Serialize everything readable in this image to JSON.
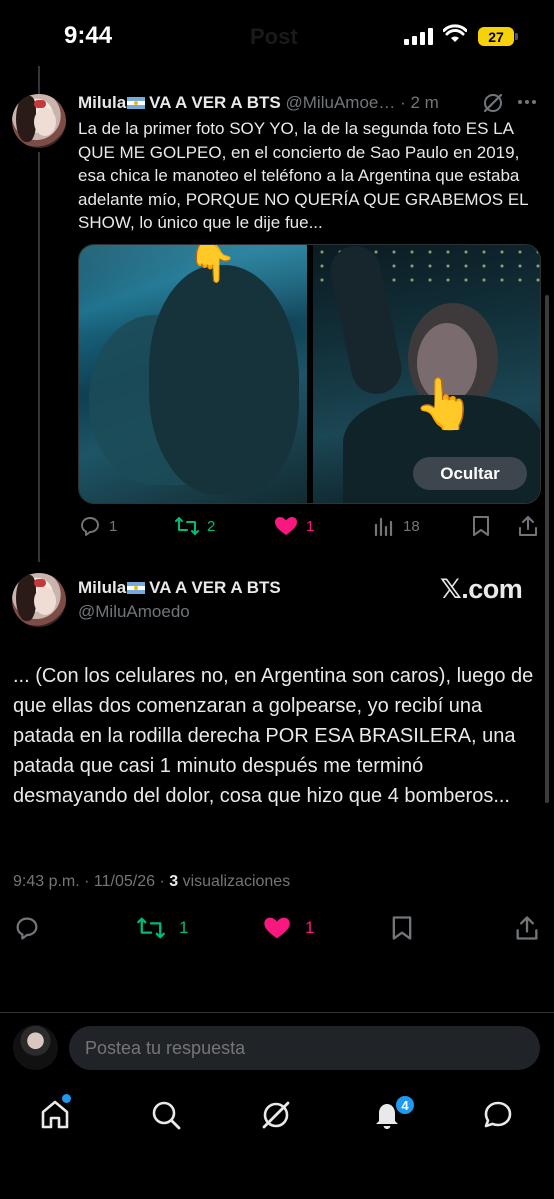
{
  "status_bar": {
    "time": "9:44",
    "battery": "27",
    "header_title": "Post"
  },
  "reply_post": {
    "display_name": "Milula",
    "name_suffix": "VA A VER A BTS",
    "handle": "@MiluAmoe…",
    "time": "· 2 m",
    "text": "La de la primer foto SOY YO, la de la segunda foto ES LA QUE ME GOLPEO, en el concierto de Sao Paulo en 2019, esa chica le manoteo el teléfono a la Argentina que estaba adelante mío, PORQUE NO QUERÍA QUE GRABEMOS EL SHOW, lo único que le dije fue...",
    "hide_button": "Ocultar",
    "hand_emoji_1": "👆",
    "hand_emoji_2": "👆",
    "replies": "1",
    "reposts": "2",
    "likes": "1",
    "views": "18"
  },
  "main_post": {
    "display_name": "Milula",
    "name_suffix": "VA A VER A BTS",
    "handle": "@MiluAmoedo",
    "brand": "𝕏.com",
    "text": "... (Con los celulares no, en Argentina son caros), luego de que ellas dos comenzaran a golpearse, yo recibí una patada en la rodilla derecha POR ESA BRASILERA, una patada que  casi 1 minuto después me terminó desmayando del dolor, cosa que hizo que 4 bomberos...",
    "timestamp": "9:43 p.m. · 11/05/26 · ",
    "views_count": "3",
    "views_label": " visualizaciones",
    "reposts": "1",
    "likes": "1"
  },
  "reply_box": {
    "placeholder": "Postea tu respuesta"
  },
  "bottom_nav": {
    "notifications_badge": "4"
  },
  "colors": {
    "accent": "#1d9bf0",
    "like": "#f91880",
    "repost": "#00ba7c",
    "muted": "#71767b"
  }
}
